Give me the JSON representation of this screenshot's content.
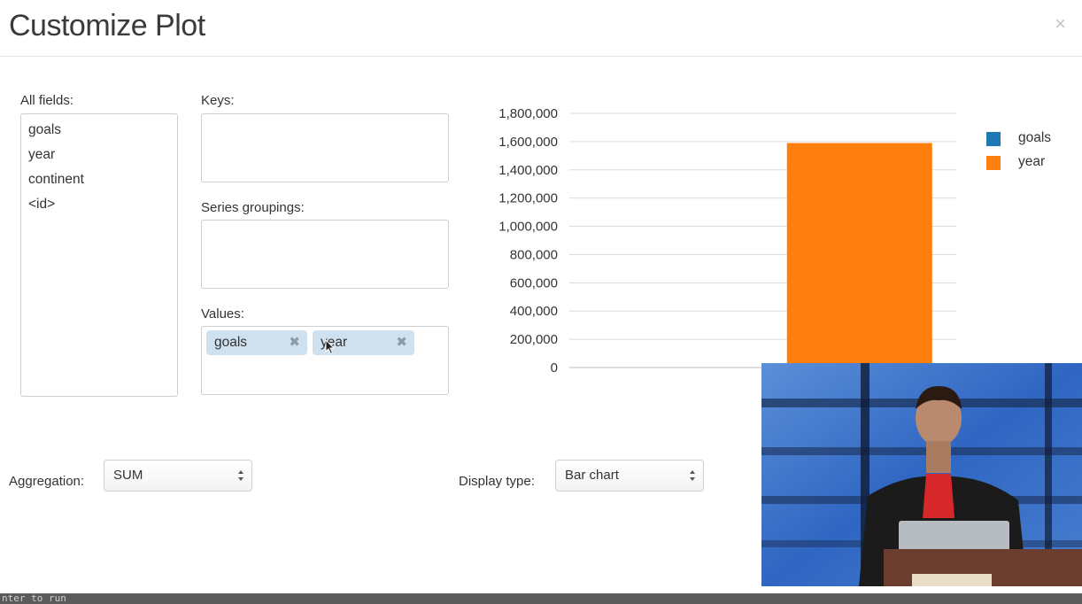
{
  "modal": {
    "title": "Customize Plot",
    "close_symbol": "×"
  },
  "fields": {
    "all_fields_label": "All fields:",
    "all_fields": [
      "goals",
      "year",
      "continent",
      "<id>"
    ],
    "keys_label": "Keys:",
    "series_groupings_label": "Series groupings:",
    "values_label": "Values:",
    "values_chips": [
      {
        "label": "goals",
        "remove_symbol": "✖"
      },
      {
        "label": "year",
        "remove_symbol": "✖"
      }
    ]
  },
  "controls": {
    "aggregation_label": "Aggregation:",
    "aggregation_value": "SUM",
    "display_type_label": "Display type:",
    "display_type_value": "Bar chart"
  },
  "chart_data": {
    "type": "bar",
    "categories": [
      "",
      ""
    ],
    "series": [
      {
        "name": "goals",
        "values": [
          0,
          0
        ],
        "color": "#1f77b4"
      },
      {
        "name": "year",
        "values": [
          0,
          1590000
        ],
        "color": "#ff7f0e"
      }
    ],
    "ylim": [
      0,
      1800000
    ],
    "yticks": [
      "1,800,000",
      "1,600,000",
      "1,400,000",
      "1,200,000",
      "1,000,000",
      "800,000",
      "600,000",
      "400,000",
      "200,000",
      "0"
    ],
    "grid": true,
    "legend": "top-right"
  },
  "bottom_bar_text": "nter to run"
}
